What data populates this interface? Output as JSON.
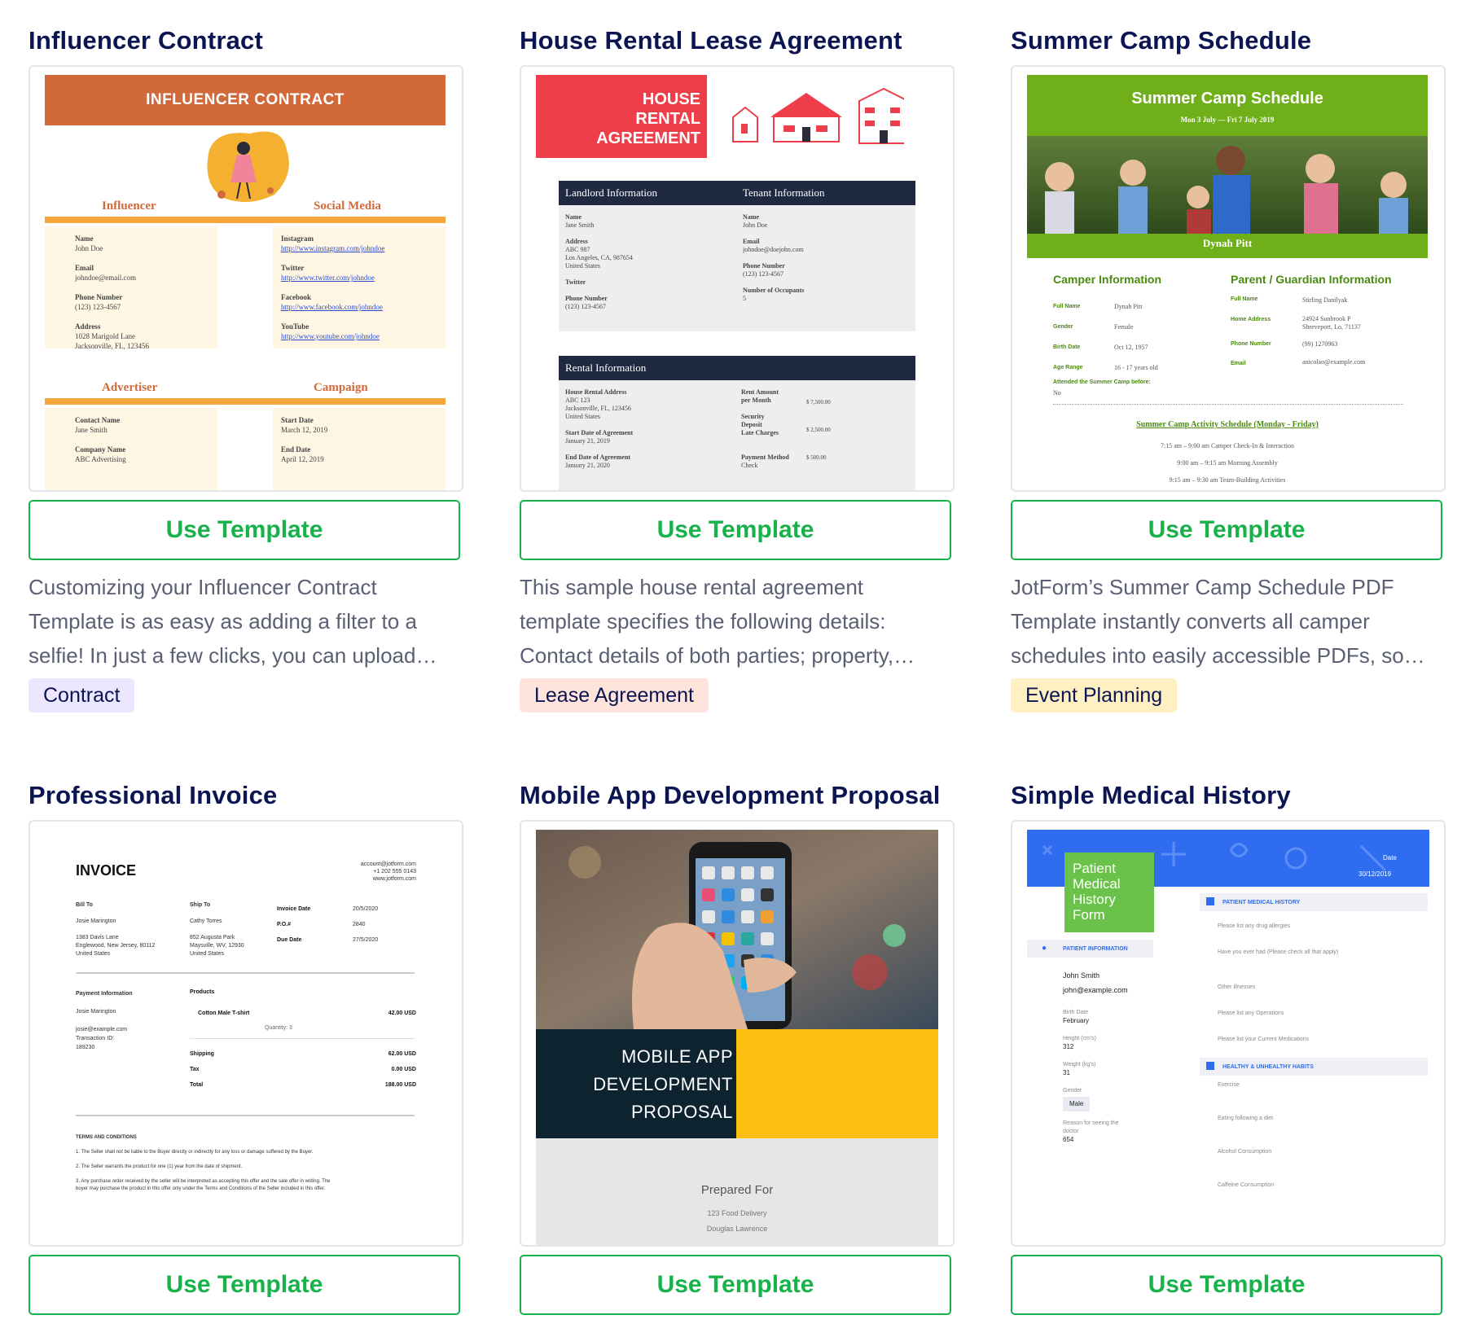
{
  "cards": [
    {
      "title": "Influencer Contract",
      "button": "Use Template",
      "desc": [
        "Customizing your Influencer Contract",
        "Template is as easy as adding a filter to a",
        "selfie! In just a few clicks, you can upload…"
      ],
      "tag": "Contract",
      "preview": {
        "header": "INFLUENCER CONTRACT",
        "sec1": "Influencer",
        "sec2": "Social Media",
        "sec3": "Advertiser",
        "sec4": "Campaign",
        "name_l": "Name",
        "name_v": "John Doe",
        "email_l": "Email",
        "email_v": "johndoe@email.com",
        "phone_l": "Phone Number",
        "phone_v": "(123) 123-4567",
        "addr_l": "Address",
        "addr_v1": "1028 Marigold Lane",
        "addr_v2": "Jacksonville, FL, 123456",
        "ig_l": "Instagram",
        "ig_v": "http://www.instagram.com/johndoe",
        "tw_l": "Twitter",
        "tw_v": "http://www.twitter.com/johndoe",
        "fb_l": "Facebook",
        "fb_v": "http://www.facebook.com/johndoe",
        "yt_l": "YouTube",
        "yt_v": "http://www.youtube.com/johndoe",
        "cn_l": "Contact Name",
        "cn_v": "Jane Smith",
        "co_l": "Company Name",
        "co_v": "ABC Advertising",
        "sd_l": "Start Date",
        "sd_v": "March 12, 2019",
        "ed_l": "End Date",
        "ed_v": "April 12, 2019"
      }
    },
    {
      "title": "House Rental Lease Agreement",
      "button": "Use Template",
      "desc": [
        "This sample house rental agreement",
        "template specifies the following details:",
        "Contact details of both parties; property,…"
      ],
      "tag": "Lease Agreement",
      "preview": {
        "header1": "HOUSE",
        "header2": "RENTAL",
        "header3": "AGREEMENT",
        "landlord": "Landlord Information",
        "tenant": "Tenant Information",
        "l_name_l": "Name",
        "l_name_v": "Jane Smith",
        "l_addr_l": "Address",
        "l_addr_v1": "ABC 987",
        "l_addr_v2": "Los Angeles, CA, 987654",
        "l_addr_v3": "United States",
        "l_tw_l": "Twitter",
        "l_ph_l": "Phone Number",
        "l_ph_v": "(123) 123-4567",
        "t_name_l": "Name",
        "t_name_v": "John Doe",
        "t_email_l": "Email",
        "t_email_v": "johndoe@doejohn.com",
        "t_ph_l": "Phone Number",
        "t_ph_v": "(123) 123-4567",
        "t_occ_l": "Number of Occupants",
        "t_occ_v": "5",
        "rental": "Rental Information",
        "r_addr_l": "House Rental Address",
        "r_addr_v1": "ABC 123",
        "r_addr_v2": "Jacksonville, FL, 123456",
        "r_addr_v3": "United States",
        "r_sd_l": "Start Date of Agreement",
        "r_sd_v": "January 21, 2019",
        "r_ed_l": "End Date of Agreement",
        "r_ed_v": "January 21, 2020",
        "r_rent_l1": "Rent Amount",
        "r_rent_l2": "per Month",
        "r_rent_v": "$ 7,500.00",
        "r_sec_l": "Security",
        "r_sec_l2": "Deposit",
        "r_sec_v": "$ 2,500.00",
        "r_late_l": "Late Charges",
        "r_late_v": "$ 500.00",
        "r_pay_l": "Payment Method",
        "r_pay_v": "Check"
      }
    },
    {
      "title": "Summer Camp Schedule",
      "button": "Use Template",
      "desc": [
        "JotForm’s Summer Camp Schedule PDF",
        "Template instantly converts all camper",
        "schedules into easily accessible PDFs, so…"
      ],
      "tag": "Event Planning",
      "preview": {
        "header": "Summer Camp Schedule",
        "dates": "Mon 3 July — Fri 7 July 2019",
        "name": "Dynah Pitt",
        "camper": "Camper Information",
        "parent": "Parent / Guardian Information",
        "fn_l": "Full Name",
        "fn_v": "Dynah Pitt",
        "g_l": "Gender",
        "g_v": "Female",
        "bd_l": "Birth Date",
        "bd_v": "Oct 12, 1957",
        "ar_l": "Age Range",
        "ar_v": "16 - 17 years old",
        "pfn_l": "Full Name",
        "pfn_v": "Stirling Danilyak",
        "ha_l": "Home Address",
        "ha_v1": "24924 Sunbrook P",
        "ha_v2": "Shreveport, Lo, 71137",
        "pn_l": "Phone Number",
        "pn_v": "(99) 1270963",
        "em_l": "Email",
        "em_v": "anicolao@example.com",
        "att_l": "Attended the Summer Camp before:",
        "att_v": "No",
        "act": "Summer Camp Activity Schedule (Monday - Friday)",
        "act1": "7:15 am – 9:00 am Camper Check-In & Interaction",
        "act2": "9:00 am – 9:15 am Morning Assembly",
        "act3": "9:15 am – 9:30 am Team-Building Activities"
      }
    },
    {
      "title": "Professional Invoice",
      "button": "Use Template",
      "preview": {
        "heading": "INVOICE",
        "contact1": "account@jotform.com",
        "contact2": "+1 202 555 0143",
        "contact3": "www.jotform.com",
        "billto": "Bill To",
        "billto_v1": "Josie Marington",
        "billto_v2": "1383 Davis Lane",
        "billto_v3": "Englewood, New Jersey, 80112",
        "billto_v4": "United States",
        "shipto": "Ship To",
        "shipto_v1": "Cathy Torres",
        "shipto_v2": "852 Augusta Park",
        "shipto_v3": "Maysville, WV, 12930",
        "shipto_v4": "United States",
        "inv_date_l": "Invoice Date",
        "inv_date_v": "20/5/2020",
        "po_l": "P.O.#",
        "po_v": "2840",
        "due_l": "Due Date",
        "due_v": "27/5/2020",
        "pay_info": "Payment Information",
        "pay_v1": "Josie Marington",
        "pay_v2": "josie@example.com",
        "pay_v3": "Transaction ID:",
        "pay_v4": "189230",
        "products": "Products",
        "prod1": "Cotton Male T-shirt",
        "prod1_price": "42.00 USD",
        "qty": "Quantity: 3",
        "ship_l": "Shipping",
        "ship_v": "62.00 USD",
        "tax_l": "Tax",
        "tax_v": "0.00 USD",
        "total_l": "Total",
        "total_v": "188.00 USD",
        "terms": "TERMS AND CONDITIONS",
        "t1": "1. The Seller shall not be liable to the Buyer directly or indirectly for any loss or damage suffered by the Buyer.",
        "t2": "2. The Seller warrants the product for one (1) year from the date of shipment.",
        "t3a": "3. Any purchase order received by the seller will be interpreted as accepting this offer and the sale offer in writing. The",
        "t3b": "buyer may purchase the product in this offer only under the Terms and Conditions of the Seller included in this offer."
      }
    },
    {
      "title": "Mobile App Development Proposal",
      "button": "Use Template",
      "preview": {
        "l1": "MOBILE APP",
        "l2": "DEVELOPMENT",
        "l3": "PROPOSAL",
        "prepared": "Prepared For",
        "p1": "123 Food Delivery",
        "p2": "Douglas Lawrence"
      }
    },
    {
      "title": "Simple Medical History",
      "button": "Use Template",
      "preview": {
        "badge1": "Patient",
        "badge2": "Medical",
        "badge3": "History",
        "badge4": "Form",
        "date_l": "Date",
        "date_v": "30/12/2019",
        "pmh": "PATIENT MEDICAL HISTORY",
        "pi": "PATIENT INFORMATION",
        "name": "John Smith",
        "email": "john@example.com",
        "bd_l": "Birth Date",
        "bd_v": "February",
        "h_l": "Height (cm's)",
        "h_v": "312",
        "w_l": "Weight (kg's)",
        "w_v": "31",
        "g_l": "Gender",
        "g_v": "Male",
        "r_l1": "Reason for seeing the",
        "r_l2": "doctor",
        "r_v": "654",
        "q1": "Please list any drug allergies",
        "q2": "Have you ever had (Please check all that apply)",
        "q3": "Other illnesses",
        "q4": "Please list any Operations",
        "q5": "Please list your Current Medications",
        "hh": "HEALTHY & UNHEALTHY HABITS",
        "q6": "Exercise",
        "q7": "Eating following a diet",
        "q8": "Alcohol Consumption",
        "q9": "Caffeine Consumption"
      }
    }
  ],
  "colors": {
    "title": "#0a1551",
    "button_green": "#18b24b",
    "tag_contract": "#ece7ff",
    "tag_lease": "#ffe4dc",
    "tag_event": "#fff0c4"
  }
}
